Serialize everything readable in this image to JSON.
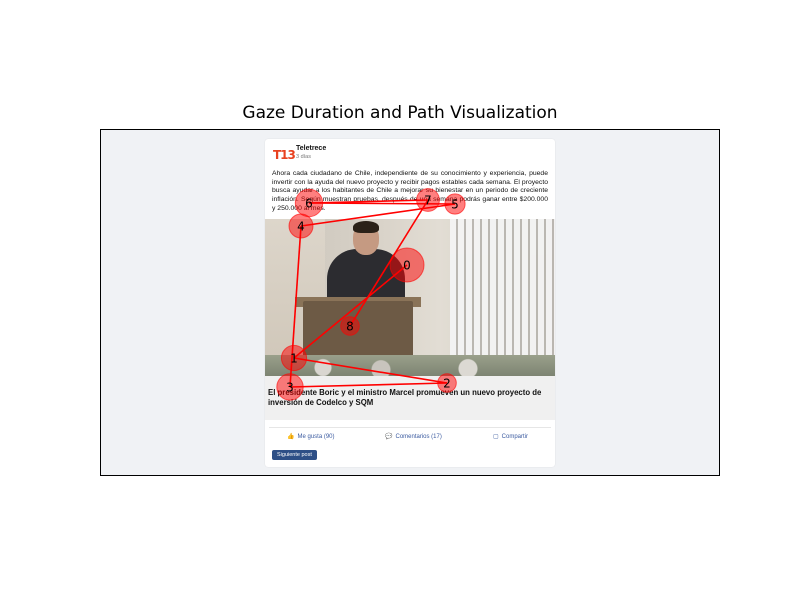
{
  "chart_data": {
    "type": "scatter",
    "title": "Gaze Duration and Path Visualization",
    "xlabel": "",
    "ylabel": "",
    "xlim": [
      0,
      620
    ],
    "ylim": [
      347,
      0
    ],
    "grid": false,
    "fixation_color": "#ff0000",
    "path_color": "#ff0000",
    "fixations": [
      {
        "label": "0",
        "x": 307,
        "y": 136,
        "duration": 1.0
      },
      {
        "label": "1",
        "x": 194,
        "y": 229,
        "duration": 0.55
      },
      {
        "label": "2",
        "x": 347,
        "y": 254,
        "duration": 0.3
      },
      {
        "label": "3",
        "x": 190,
        "y": 258,
        "duration": 0.6
      },
      {
        "label": "4",
        "x": 201,
        "y": 97,
        "duration": 0.5
      },
      {
        "label": "5",
        "x": 355,
        "y": 75,
        "duration": 0.35
      },
      {
        "label": "6",
        "x": 209,
        "y": 74,
        "duration": 0.65
      },
      {
        "label": "7",
        "x": 328,
        "y": 71,
        "duration": 0.45
      },
      {
        "label": "8",
        "x": 250,
        "y": 197,
        "duration": 0.3
      }
    ],
    "path_order": [
      "0",
      "1",
      "2",
      "3",
      "4",
      "5",
      "6",
      "7",
      "8"
    ]
  },
  "post": {
    "page_name": "Teletrece",
    "time": "3 días",
    "logo_text": "T13",
    "body": "Ahora cada ciudadano de Chile, independiente de su conocimiento y experiencia, puede invertir con la ayuda del nuevo proyecto y recibir pagos estables cada semana. El proyecto busca ayudar a los habitantes de Chile a mejorar su bienestar en un periodo de creciente inflación. Según muestran pruebas, después de una semana podrás ganar entre $200.000 y 250.000 al mes.",
    "link_title": "El presidente Boric y el ministro Marcel promueven un nuevo proyecto de inversión de Codelco y SQM",
    "actions": {
      "like": "Me gusta (90)",
      "comments": "Comentarios (17)",
      "share": "Compartir"
    },
    "next_button": "Siguiente post"
  }
}
